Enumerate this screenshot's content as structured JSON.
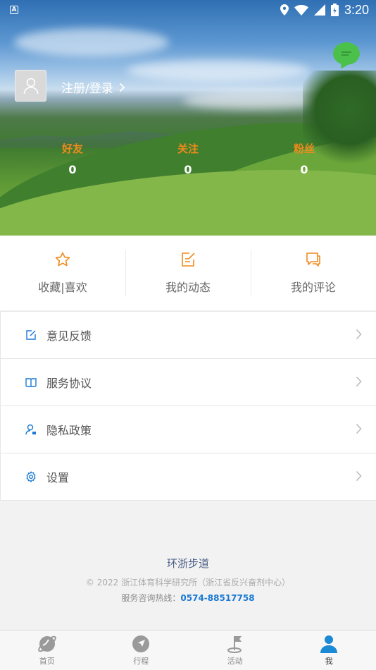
{
  "status_bar": {
    "time": "3:20"
  },
  "profile": {
    "login_label": "注册/登录"
  },
  "stats": [
    {
      "label": "好友",
      "value": "0"
    },
    {
      "label": "关注",
      "value": "0"
    },
    {
      "label": "粉丝",
      "value": "0"
    }
  ],
  "actions": [
    {
      "label": "收藏|喜欢",
      "icon": "star-icon"
    },
    {
      "label": "我的动态",
      "icon": "edit-note-icon"
    },
    {
      "label": "我的评论",
      "icon": "comment-icon"
    }
  ],
  "menu": [
    {
      "label": "意见反馈",
      "icon": "feedback-icon"
    },
    {
      "label": "服务协议",
      "icon": "book-icon"
    },
    {
      "label": "隐私政策",
      "icon": "user-privacy-icon"
    },
    {
      "label": "设置",
      "icon": "gear-icon"
    }
  ],
  "footer": {
    "title": "环浙步道",
    "copyright": "© 2022 浙江体育科学研究所（浙江省反兴奋剂中心）",
    "hotline_label": "服务咨询热线：",
    "hotline_number": "0574-88517758"
  },
  "tabs": [
    {
      "label": "首页",
      "icon": "home-planet-icon"
    },
    {
      "label": "行程",
      "icon": "compass-icon"
    },
    {
      "label": "活动",
      "icon": "flag-icon"
    },
    {
      "label": "我",
      "icon": "person-icon",
      "active": true
    }
  ],
  "colors": {
    "accent_orange": "#f08a1c",
    "link_blue": "#1a79d4",
    "chat_green": "#4bc14b"
  }
}
